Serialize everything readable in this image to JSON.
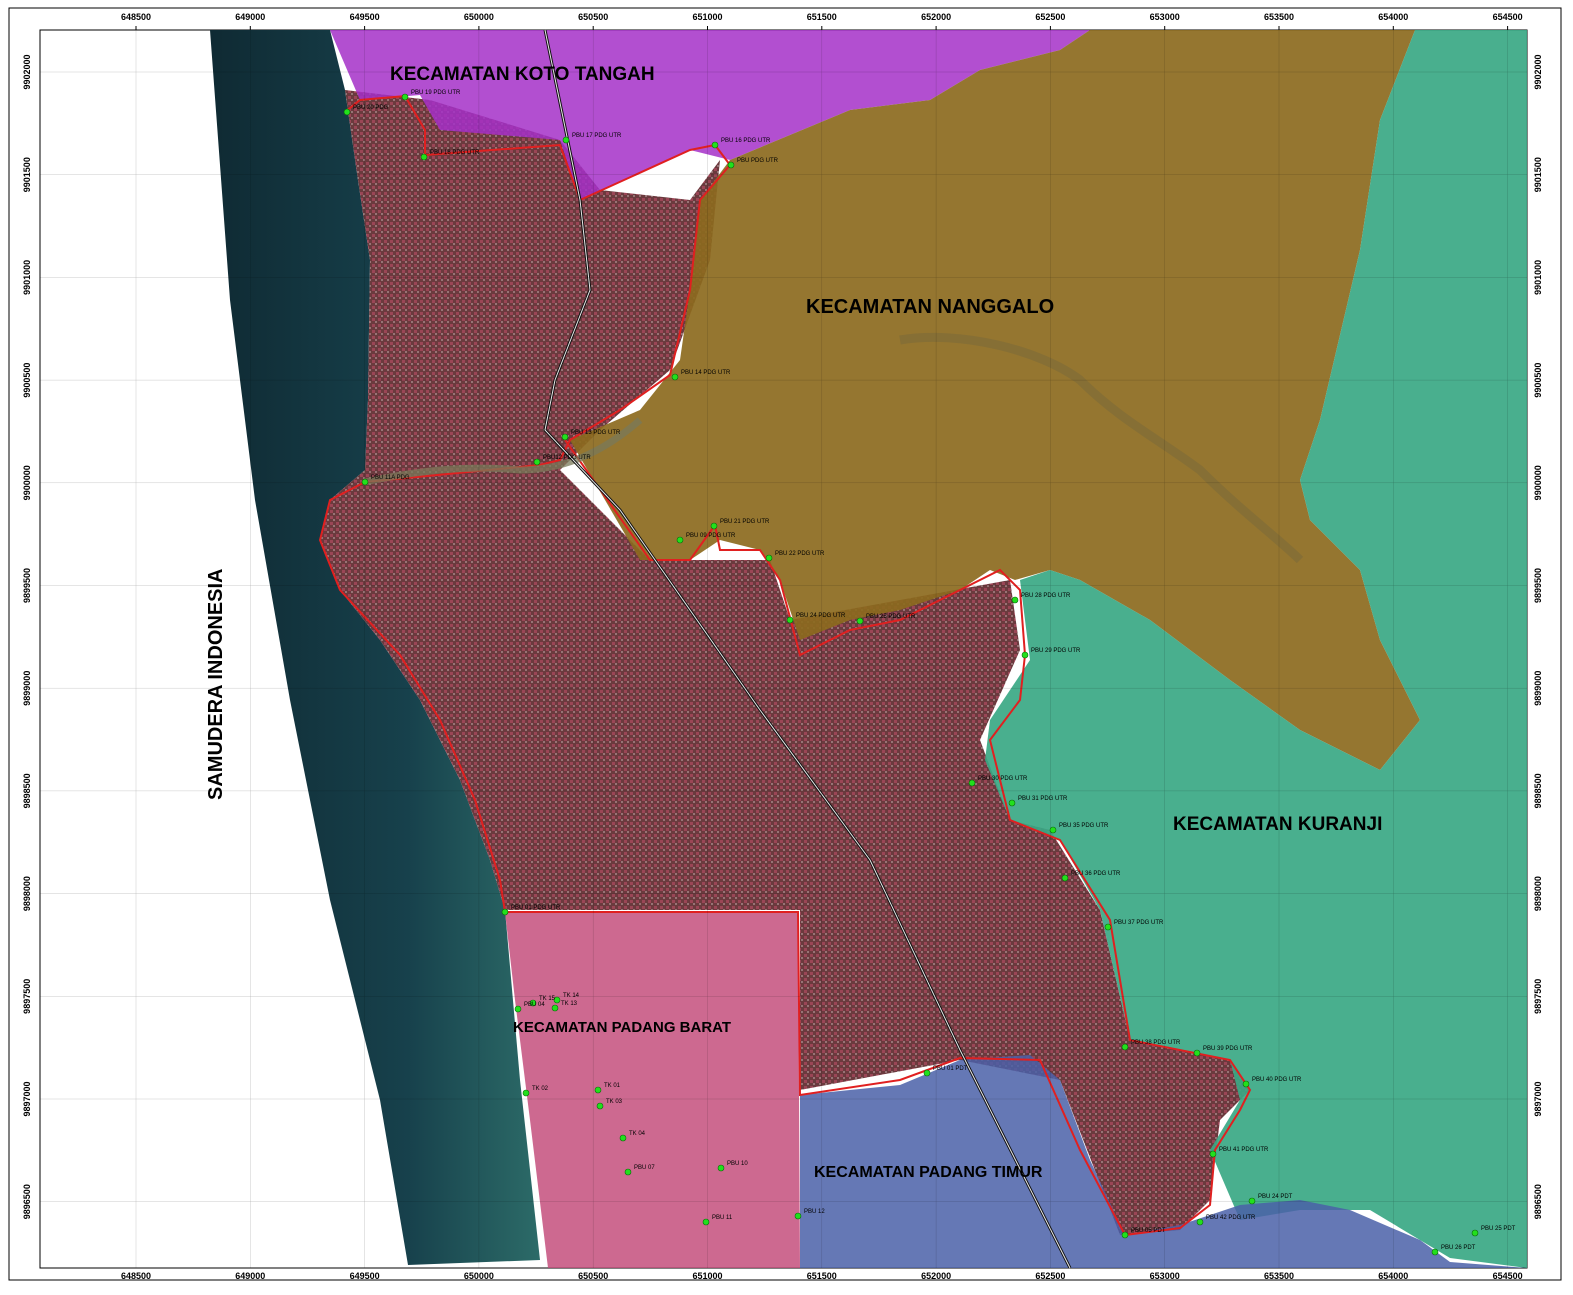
{
  "map": {
    "ocean_label": "SAMUDERA INDONESIA",
    "districts": [
      {
        "id": "koto-tangah",
        "label": "KECAMATAN KOTO TANGAH",
        "color": "#a530c8"
      },
      {
        "id": "nanggalo",
        "label": "KECAMATAN NANGGALO",
        "color": "#8c6a1e"
      },
      {
        "id": "kuranji",
        "label": "KECAMATAN KURANJI",
        "color": "#3aa884"
      },
      {
        "id": "padang-barat",
        "label": "KECAMATAN PADANG BARAT",
        "color": "#c24878"
      },
      {
        "id": "padang-timur",
        "label": "KECAMATAN PADANG TIMUR",
        "color": "#4a60a8"
      }
    ],
    "x_ticks": [
      "648500",
      "649000",
      "649500",
      "650000",
      "650500",
      "651000",
      "651500",
      "652000",
      "652500",
      "653000",
      "653500",
      "654000",
      "654500"
    ],
    "y_ticks": [
      "9902000",
      "9901500",
      "9901000",
      "9900500",
      "9900000",
      "9899500",
      "9899000",
      "9898500",
      "9898000",
      "9897500",
      "9897000",
      "9896500"
    ],
    "points": [
      "PBU 19 PDG UTR",
      "PBU 20 PDG",
      "PBU 18 PDG UTR",
      "PBU 17 PDG UTR",
      "PBU 16 PDG UTR",
      "PBU PDG UTR",
      "PBU 14 PDG UTR",
      "PBU 13 PDG UTR",
      "PBU12 PDG UTR",
      "PBU 11A PDG",
      "PBU 21 PDG UTR",
      "PBU 09 PDG UTR",
      "PBU 22 PDG UTR",
      "PBU 24 PDG UTR",
      "PBU 25 PDG UTR",
      "PBU 28 PDG UTR",
      "PBU 29 PDG UTR",
      "PBU 30 PDG UTR",
      "PBU 31 PDG UTR",
      "PBU 35 PDG UTR",
      "PBU 36 PDG UTR",
      "PBU 37 PDG UTR",
      "PBU 01 PDG UTR",
      "PBU 38 PDG UTR",
      "PBU 39 PDG UTR",
      "PBU 40 PDG UTR",
      "PBU 41 PDG UTR",
      "PBU 24 PDT",
      "PBU 25 PDT",
      "PBU 26 PDT",
      "PBU 05 PDT",
      "PBU 42 PDG UTR",
      "TK 14",
      "TK 15",
      "TK 13",
      "PBU 04",
      "TK 01",
      "TK 02",
      "TK 03",
      "TK 04",
      "PBU 07",
      "PBU 10",
      "PBU 11",
      "PBU 12",
      "PBU 01 PDT"
    ]
  }
}
